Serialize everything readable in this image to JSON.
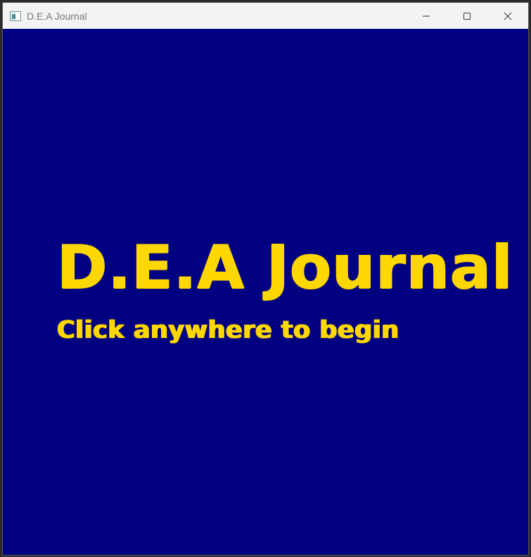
{
  "window": {
    "title": "D.E.A Journal",
    "controls": {
      "minimize_icon": "minimize-icon",
      "maximize_icon": "maximize-icon",
      "close_icon": "close-icon"
    }
  },
  "main": {
    "title": "D.E.A Journal",
    "subtitle": "Click anywhere to begin"
  },
  "colors": {
    "background": "#000080",
    "text": "#ffd700",
    "titlebar": "#f3f3f3"
  }
}
